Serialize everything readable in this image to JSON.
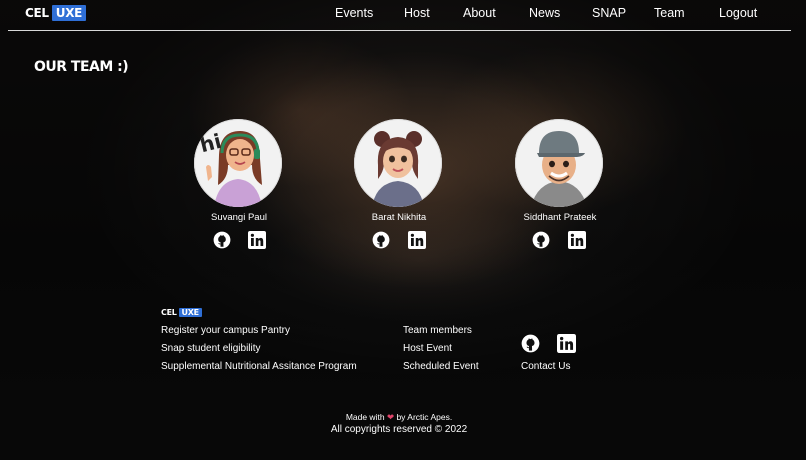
{
  "brand": {
    "left": "CEL",
    "right": "UXE",
    "accent": "#2f6fd6"
  },
  "nav": {
    "items": [
      {
        "label": "Events"
      },
      {
        "label": "Host"
      },
      {
        "label": "About"
      },
      {
        "label": "News"
      },
      {
        "label": "SNAP"
      },
      {
        "label": "Team"
      },
      {
        "label": "Logout"
      }
    ]
  },
  "team": {
    "title": "OUR TEAM :)",
    "members": [
      {
        "name": "Suvangi Paul",
        "avatar_caption": "hi",
        "icons": [
          "github-icon",
          "linkedin-icon"
        ]
      },
      {
        "name": "Barat Nikhita",
        "icons": [
          "github-icon",
          "linkedin-icon"
        ]
      },
      {
        "name": "Siddhant Prateek",
        "icons": [
          "github-icon",
          "linkedin-icon"
        ]
      }
    ]
  },
  "footer": {
    "column1": [
      "Register your campus Pantry",
      "Snap student eligibility",
      "Supplemental Nutritional Assitance Program"
    ],
    "column2": [
      "Team members",
      "Host Event",
      "Scheduled Event"
    ],
    "contact": "Contact Us",
    "social_icons": [
      "github-icon",
      "linkedin-icon"
    ],
    "made_with_prefix": "Made with",
    "heart_icon": "heart-icon",
    "heart_color": "#e0446a",
    "made_with_suffix": "by Arctic Apes.",
    "copyright": "All copyrights reserved © 2022"
  }
}
